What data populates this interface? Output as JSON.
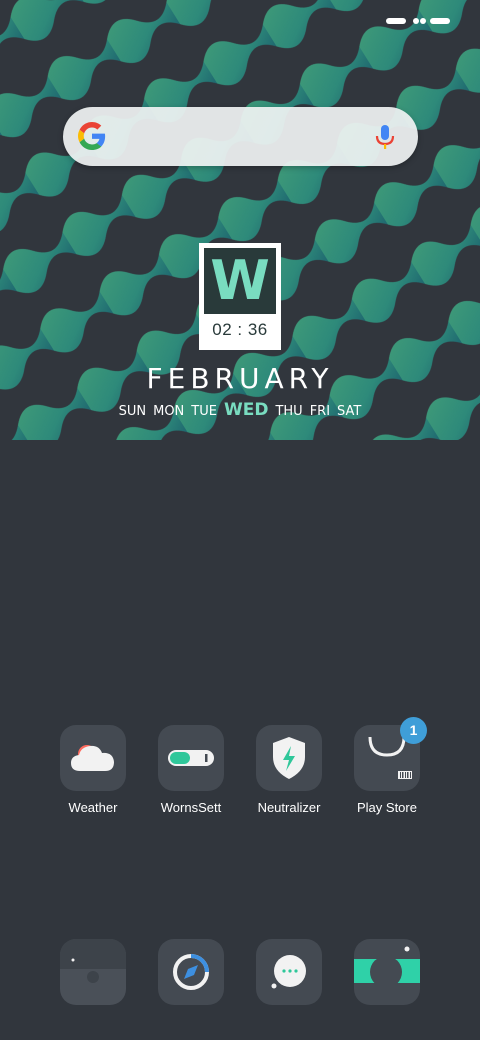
{
  "wallpaper": {
    "colors": [
      "#3b8a72",
      "#1e5f6a",
      "#31363d"
    ]
  },
  "status_bar": {
    "icons": [
      "pill-indicator",
      "dots-indicator",
      "pill-indicator"
    ]
  },
  "search": {
    "logo": "google-g-icon",
    "mic": "mic-icon",
    "placeholder": ""
  },
  "clock_widget": {
    "letter": "W",
    "time": "02 : 36",
    "month": "FEBRUARY",
    "weekdays": [
      "SUN",
      "MON",
      "TUE",
      "WED",
      "THU",
      "FRI",
      "SAT"
    ],
    "active_day": "WED",
    "accent": "#79dcc0"
  },
  "apps": [
    {
      "label": "Weather",
      "icon": "cloud-icon"
    },
    {
      "label": "WornsSett",
      "icon": "toggle-icon"
    },
    {
      "label": "Neutralizer",
      "icon": "shield-bolt-icon"
    },
    {
      "label": "Play Store",
      "icon": "bag-icon",
      "badge": "1"
    }
  ],
  "dock": [
    {
      "icon": "phone-frame-icon"
    },
    {
      "icon": "compass-icon"
    },
    {
      "icon": "chat-bubble-icon"
    },
    {
      "icon": "camera-icon"
    }
  ]
}
